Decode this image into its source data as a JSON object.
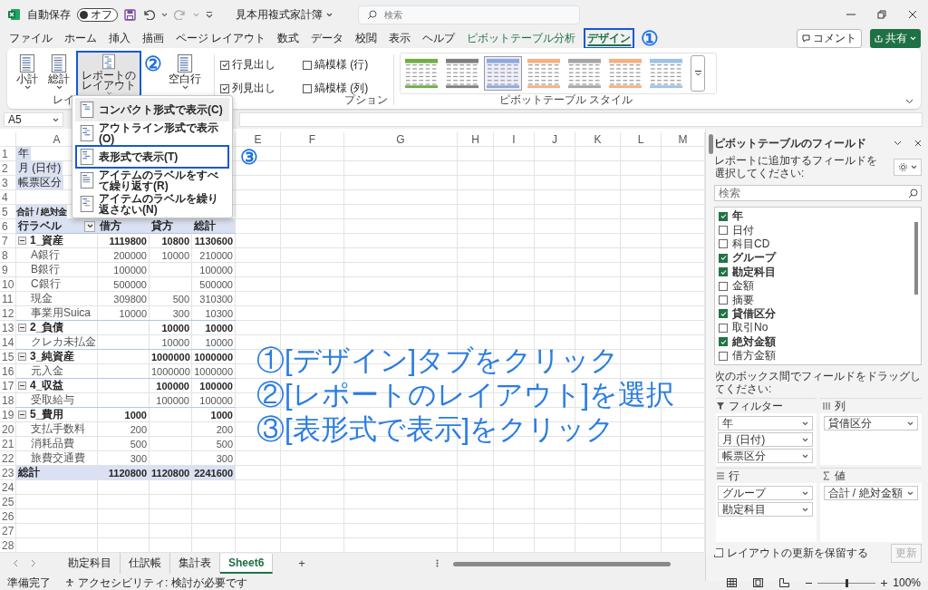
{
  "title_bar": {
    "autosave_label": "自動保存",
    "autosave": {
      "on": false,
      "label": "オフ"
    },
    "document_title": "見本用複式家計簿",
    "search_placeholder": "検索"
  },
  "ribbon_tabs": [
    {
      "label": "ファイル",
      "kind": "standard",
      "selected": false,
      "highlighted": false
    },
    {
      "label": "ホーム",
      "kind": "standard",
      "selected": false,
      "highlighted": false
    },
    {
      "label": "挿入",
      "kind": "standard",
      "selected": false,
      "highlighted": false
    },
    {
      "label": "描画",
      "kind": "standard",
      "selected": false,
      "highlighted": false
    },
    {
      "label": "ページ レイアウト",
      "kind": "standard",
      "selected": false,
      "highlighted": false
    },
    {
      "label": "数式",
      "kind": "standard",
      "selected": false,
      "highlighted": false
    },
    {
      "label": "データ",
      "kind": "standard",
      "selected": false,
      "highlighted": false
    },
    {
      "label": "校閲",
      "kind": "standard",
      "selected": false,
      "highlighted": false
    },
    {
      "label": "表示",
      "kind": "standard",
      "selected": false,
      "highlighted": false
    },
    {
      "label": "ヘルプ",
      "kind": "standard",
      "selected": false,
      "highlighted": false
    },
    {
      "label": "ピボットテーブル分析",
      "kind": "contextual",
      "selected": false,
      "highlighted": false
    },
    {
      "label": "デザイン",
      "kind": "contextual",
      "selected": true,
      "highlighted": true,
      "marker": "①"
    }
  ],
  "header_buttons": [
    {
      "label": "コメント",
      "kind": "outline"
    },
    {
      "label": "共有",
      "kind": "primary"
    }
  ],
  "ribbon": {
    "layout_buttons": [
      {
        "label": "小計",
        "pressed": false,
        "highlighted": false
      },
      {
        "label": "総計",
        "pressed": false,
        "highlighted": false
      },
      {
        "label": "レポートのレイアウト",
        "pressed": true,
        "highlighted": true,
        "marker": "②"
      },
      {
        "label": "空白行",
        "pressed": false,
        "highlighted": false
      }
    ],
    "layout_group_label": "レイ",
    "style_options": [
      {
        "label": "行見出し",
        "checked": true
      },
      {
        "label": "縞模様 (行)",
        "checked": false
      },
      {
        "label": "列見出し",
        "checked": true
      },
      {
        "label": "縞模様 (列)",
        "checked": false
      }
    ],
    "options_group_label": "プション",
    "styles": [
      {
        "color": "#70ad47",
        "selected": false
      },
      {
        "color": "#7f7f7f",
        "selected": false
      },
      {
        "color": "#8ea9db",
        "selected": true
      },
      {
        "color": "#f4b183",
        "selected": false
      },
      {
        "color": "#a6a6a6",
        "selected": false
      },
      {
        "color": "#f4b183",
        "selected": false
      },
      {
        "color": "#9dc3e6",
        "selected": false
      }
    ],
    "styles_group_label": "ピボットテーブル スタイル"
  },
  "name_box": "A5",
  "layout_menu": [
    {
      "label": "コンパクト形式で表示(C)",
      "current": true,
      "highlighted": false
    },
    {
      "label": "アウトライン形式で表示(O)",
      "current": false,
      "highlighted": false
    },
    {
      "label": "表形式で表示(T)",
      "current": false,
      "highlighted": true,
      "marker": "③"
    },
    {
      "label": "アイテムのラベルをすべて繰り返す(R)",
      "current": false,
      "highlighted": false
    },
    {
      "label": "アイテムのラベルを繰り返さない(N)",
      "current": false,
      "highlighted": false
    }
  ],
  "sheet": {
    "column_headers": [
      "A",
      "E",
      "F",
      "G",
      "H",
      "I",
      "J",
      "K",
      "L",
      "M"
    ],
    "rows": [
      {
        "number": "1",
        "kind": "filter",
        "label": "年"
      },
      {
        "number": "2",
        "kind": "filter",
        "label": "月 (日付)"
      },
      {
        "number": "3",
        "kind": "filter",
        "label": "帳票区分"
      },
      {
        "number": "4",
        "kind": "blank"
      },
      {
        "number": "5",
        "kind": "value_title",
        "label": "合計 / 絶対金"
      },
      {
        "number": "6",
        "kind": "header",
        "label": "行ラベル",
        "debit": "借方",
        "credit": "貸方",
        "total": "総計"
      },
      {
        "number": "7",
        "kind": "group",
        "expanded": true,
        "label": "1_資産",
        "debit": "1119800",
        "credit": "10800",
        "total": "1130600"
      },
      {
        "number": "8",
        "kind": "item",
        "label": "A銀行",
        "debit": "200000",
        "credit": "10000",
        "total": "210000"
      },
      {
        "number": "9",
        "kind": "item",
        "label": "B銀行",
        "debit": "100000",
        "total": "100000"
      },
      {
        "number": "10",
        "kind": "item",
        "label": "C銀行",
        "debit": "500000",
        "total": "500000"
      },
      {
        "number": "11",
        "kind": "item",
        "label": "現金",
        "debit": "309800",
        "credit": "500",
        "total": "310300"
      },
      {
        "number": "12",
        "kind": "item",
        "label": "事業用Suica",
        "debit": "10000",
        "credit": "300",
        "total": "10300"
      },
      {
        "number": "13",
        "kind": "group",
        "expanded": true,
        "label": "2_負債",
        "credit": "10000",
        "total": "10000"
      },
      {
        "number": "14",
        "kind": "item",
        "label": "クレカ未払金",
        "credit": "10000",
        "total": "10000"
      },
      {
        "number": "15",
        "kind": "group",
        "expanded": true,
        "label": "3_純資産",
        "credit": "1000000",
        "total": "1000000"
      },
      {
        "number": "16",
        "kind": "item",
        "label": "元入金",
        "credit": "1000000",
        "total": "1000000"
      },
      {
        "number": "17",
        "kind": "group",
        "expanded": true,
        "label": "4_収益",
        "credit": "100000",
        "total": "100000"
      },
      {
        "number": "18",
        "kind": "item",
        "label": "受取給与",
        "credit": "100000",
        "total": "100000"
      },
      {
        "number": "19",
        "kind": "group",
        "expanded": true,
        "label": "5_費用",
        "debit": "1000",
        "total": "1000"
      },
      {
        "number": "20",
        "kind": "item",
        "label": "支払手数料",
        "debit": "200",
        "total": "200"
      },
      {
        "number": "21",
        "kind": "item",
        "label": "消耗品費",
        "debit": "500",
        "total": "500"
      },
      {
        "number": "22",
        "kind": "item",
        "label": "旅費交通費",
        "debit": "300",
        "total": "300"
      },
      {
        "number": "23",
        "kind": "grand_total",
        "label": "総計",
        "debit": "1120800",
        "credit": "1120800",
        "total": "2241600"
      },
      {
        "number": "24",
        "kind": "blank"
      },
      {
        "number": "25",
        "kind": "blank"
      },
      {
        "number": "26",
        "kind": "blank"
      },
      {
        "number": "27",
        "kind": "blank"
      },
      {
        "number": "28",
        "kind": "blank"
      }
    ]
  },
  "sheet_tabs": [
    {
      "label": "勘定科目",
      "selected": false
    },
    {
      "label": "仕訳帳",
      "selected": false
    },
    {
      "label": "集計表",
      "selected": false
    },
    {
      "label": "Sheet6",
      "selected": true
    }
  ],
  "add_sheet_label": "+",
  "field_panel": {
    "title": "ピボットテーブルのフィールド",
    "subtitle": "レポートに追加するフィールドを選択してください:",
    "search_placeholder": "検索",
    "fields": [
      {
        "label": "年",
        "checked": true
      },
      {
        "label": "日付",
        "checked": false
      },
      {
        "label": "科目CD",
        "checked": false
      },
      {
        "label": "グループ",
        "checked": true
      },
      {
        "label": "勘定科目",
        "checked": true
      },
      {
        "label": "金額",
        "checked": false
      },
      {
        "label": "摘要",
        "checked": false
      },
      {
        "label": "貸借区分",
        "checked": true
      },
      {
        "label": "取引No",
        "checked": false
      },
      {
        "label": "絶対金額",
        "checked": true
      },
      {
        "label": "借方金額",
        "checked": false
      }
    ],
    "drag_hint": "次のボックス間でフィールドをドラッグしてください:",
    "areas": [
      {
        "kind": "filters",
        "title": "フィルター",
        "items": [
          "年",
          "月 (日付)",
          "帳票区分"
        ]
      },
      {
        "kind": "columns",
        "title": "列",
        "items": [
          "貸借区分"
        ]
      },
      {
        "kind": "rows",
        "title": "行",
        "items": [
          "グループ",
          "勘定科目"
        ]
      },
      {
        "kind": "values",
        "title": "値",
        "items": [
          "合計 / 絶対金額"
        ]
      }
    ],
    "defer_update": {
      "label": "レイアウトの更新を保留する",
      "checked": false
    },
    "update_button": {
      "label": "更新",
      "disabled": true
    }
  },
  "status_bar": {
    "ready": "準備完了",
    "accessibility": "アクセシビリティ: 検討が必要です",
    "zoom": {
      "level": 0.5,
      "reading": "100%"
    }
  },
  "instructions": [
    "①[デザイン]タブをクリック",
    "②[レポートのレイアウト]を選択",
    "③[表形式で表示]をクリック"
  ]
}
